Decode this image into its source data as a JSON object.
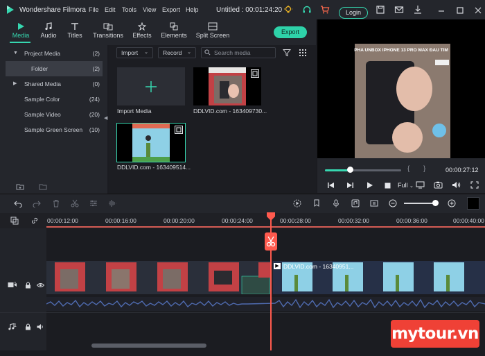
{
  "app": {
    "name": "Wondershare Filmora",
    "project_title": "Untitled : 00:01:24:20",
    "menu": [
      "File",
      "Edit",
      "Tools",
      "View",
      "Export",
      "Help"
    ],
    "login_label": "Login",
    "accent": "#36d7b0"
  },
  "media_tabs": [
    {
      "label": "Media",
      "icon": "media-icon",
      "active": true
    },
    {
      "label": "Audio",
      "icon": "audio-icon"
    },
    {
      "label": "Titles",
      "icon": "titles-icon"
    },
    {
      "label": "Transitions",
      "icon": "transitions-icon"
    },
    {
      "label": "Effects",
      "icon": "effects-icon"
    },
    {
      "label": "Elements",
      "icon": "elements-icon"
    },
    {
      "label": "Split Screen",
      "icon": "split-screen-icon"
    }
  ],
  "export_label": "Export",
  "library": [
    {
      "label": "Project Media",
      "count": "(2)",
      "expanded": true
    },
    {
      "label": "Folder",
      "count": "(2)",
      "selected": true
    },
    {
      "label": "Shared Media",
      "count": "(0)"
    },
    {
      "label": "Sample Color",
      "count": "(24)"
    },
    {
      "label": "Sample Video",
      "count": "(20)"
    },
    {
      "label": "Sample Green Screen",
      "count": "(10)"
    }
  ],
  "media_toolbar": {
    "import_label": "Import",
    "record_label": "Record",
    "search_placeholder": "Search media"
  },
  "media_items": [
    {
      "caption": "Import Media"
    },
    {
      "caption": "DDLVID.com - 163409730..."
    },
    {
      "caption": "DDLVID.com - 163409514..."
    }
  ],
  "preview": {
    "overlay_title": "PHA UNBOX IPHONE 13 PRO MAX ĐAU TIM",
    "timecode": "00:00:27:12",
    "quality": "Full",
    "scrub_progress": 0.33
  },
  "timeline": {
    "ruler": [
      "00:00:12:00",
      "00:00:16:00",
      "00:00:20:00",
      "00:00:24:00",
      "00:00:28:00",
      "00:00:32:00",
      "00:00:36:00",
      "00:00:40:00"
    ],
    "clip_label": "DDLVID.com - 16340951..."
  },
  "watermark": "mytour.vn"
}
